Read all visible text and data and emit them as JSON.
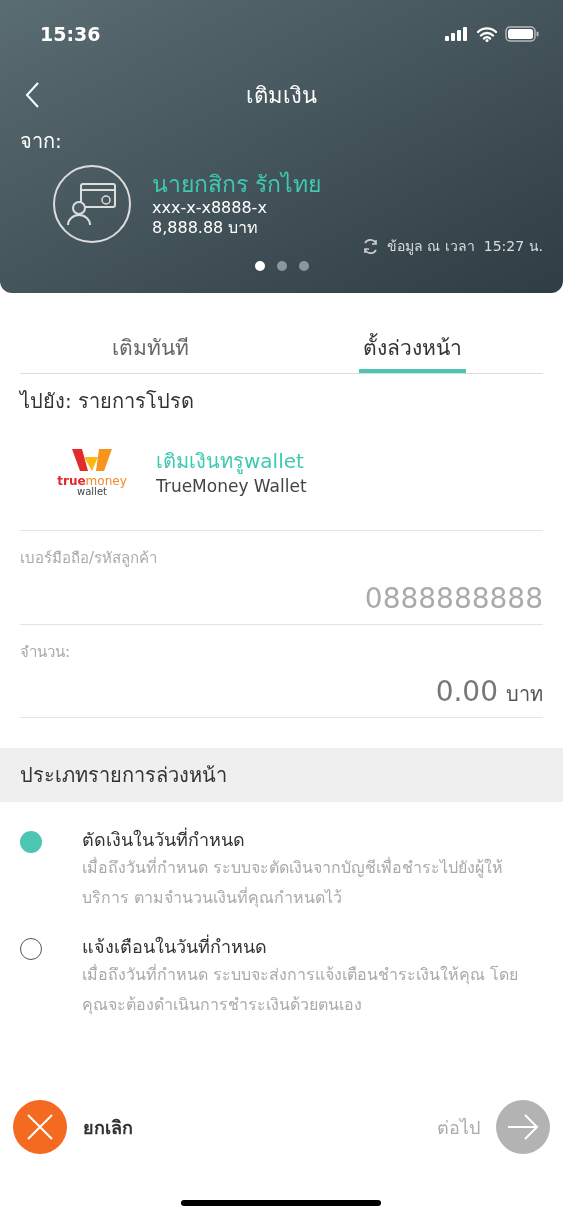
{
  "status_bar": {
    "time": "15:36"
  },
  "header": {
    "title": "เติมเงิน",
    "from_label": "จาก:"
  },
  "account": {
    "name": "นายกสิกร รักไทย",
    "number": "xxx-x-x8888-x",
    "balance": "8,888.88 บาท",
    "updated": "ข้อมูล ณ เวลา  15:27 น."
  },
  "pager": [
    {
      "selected": true
    },
    {
      "selected": false
    },
    {
      "selected": false
    }
  ],
  "tabs": [
    {
      "label": "เติมทันที",
      "selected": false
    },
    {
      "label": "ตั้งล่วงหน้า",
      "selected": true
    }
  ],
  "to_label": "ไปยัง: รายการโปรด",
  "biller": {
    "logo": {
      "word_1": "true",
      "word_2": "money",
      "line_2": "wallet"
    },
    "title": "เติมเงินทรูwallet",
    "subtitle": "TrueMoney Wallet"
  },
  "fields": [
    {
      "label": "เบอร์มือถือ/รหัสลูกค้า",
      "value": "0888888888"
    },
    {
      "label": "จำนวน:",
      "value": "0.00",
      "unit": "บาท"
    }
  ],
  "section_title": "ประเภทรายการล่วงหน้า",
  "options": [
    {
      "title": "ตัดเงินในวันที่กำหนด",
      "description": "เมื่อถึงวันที่กำหนด ระบบจะตัดเงินจากบัญชีเพื่อชำระไปยังผู้ให้บริการ ตามจำนวนเงินที่คุณกำหนดไว้",
      "selected": true
    },
    {
      "title": "แจ้งเตือนในวันที่กำหนด",
      "description": "เมื่อถึงวันที่กำหนด ระบบจะส่งการแจ้งเตือนชำระเงินให้คุณ โดยคุณจะต้องดำเนินการชำระเงินด้วยตนเอง",
      "selected": false
    }
  ],
  "footer": {
    "cancel": "ยกเลิก",
    "next": "ต่อไป",
    "next_disabled": true
  }
}
